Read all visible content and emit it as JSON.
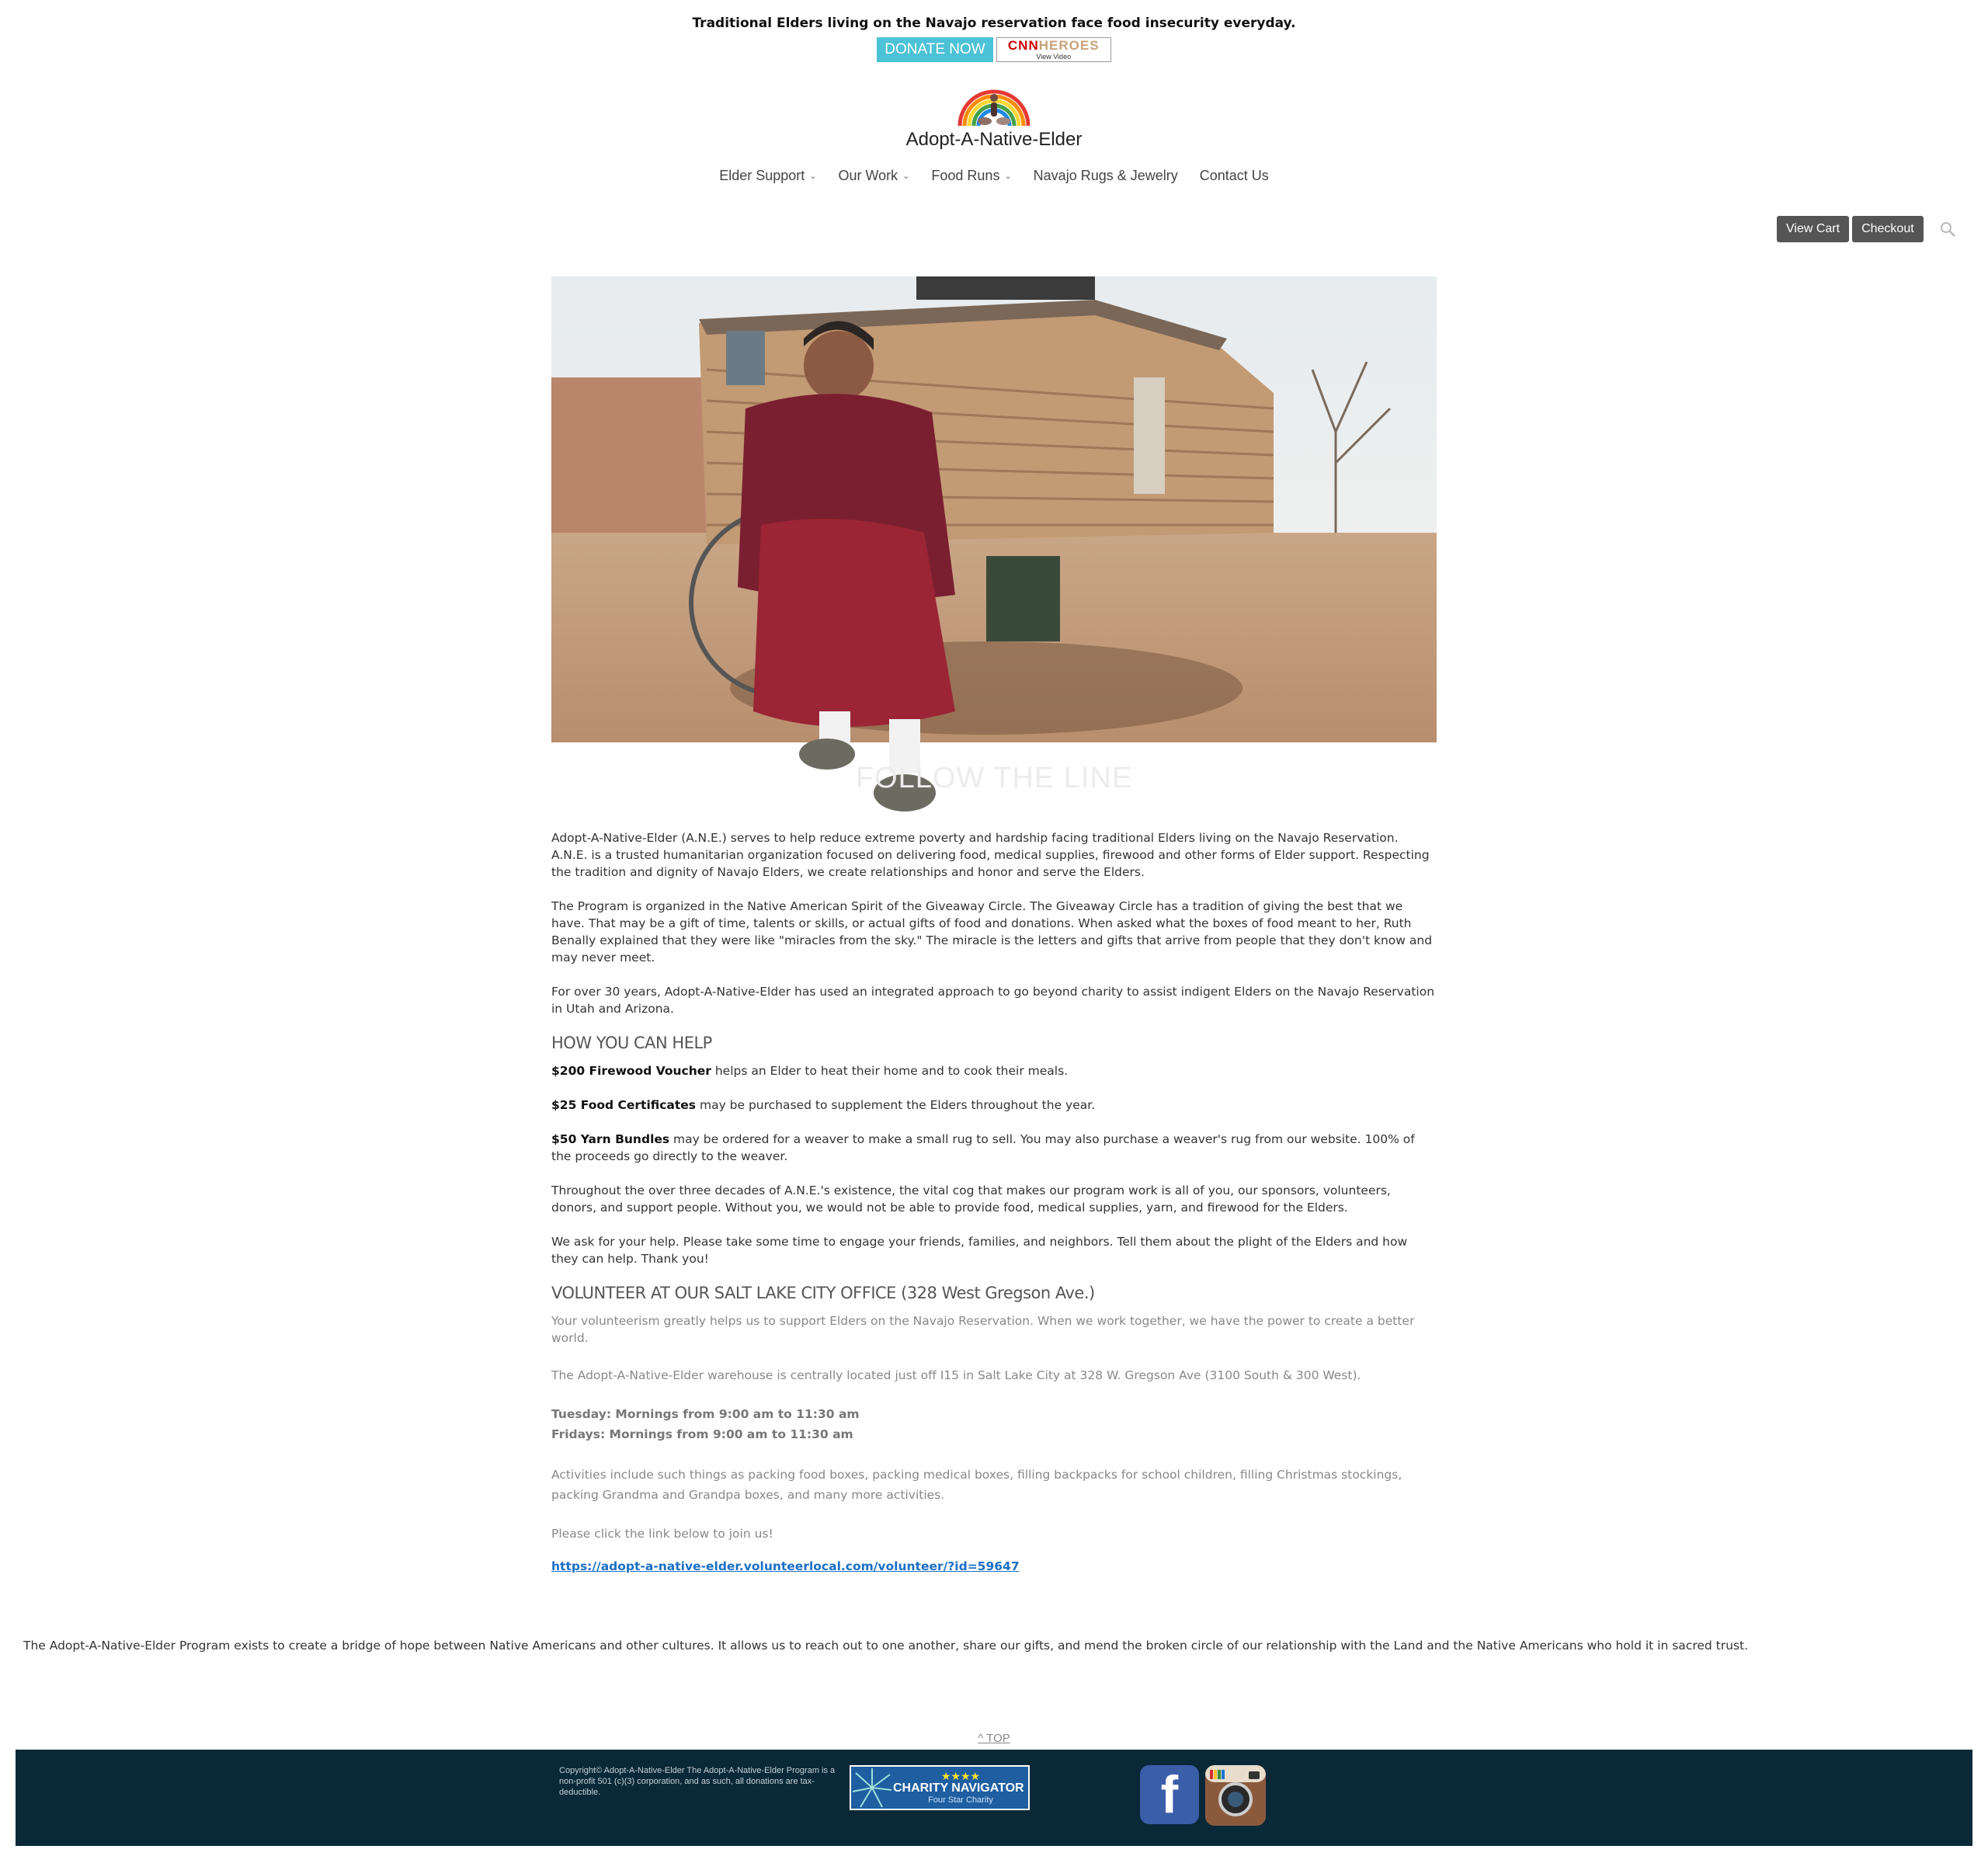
{
  "announcement": {
    "text": "Traditional Elders living on the Navajo reservation face food insecurity everyday.",
    "donate_label": "DONATE NOW",
    "cnn_logo_cnn": "CNN",
    "cnn_logo_heroes": "HEROES",
    "cnn_caption": "View Video"
  },
  "brand": {
    "name": "Adopt-A-Native-Elder"
  },
  "nav": {
    "items": [
      {
        "label": "Elder Support",
        "dropdown": true
      },
      {
        "label": "Our Work",
        "dropdown": true
      },
      {
        "label": "Food Runs",
        "dropdown": true
      },
      {
        "label": "Navajo Rugs & Jewelry",
        "dropdown": false
      },
      {
        "label": "Contact Us",
        "dropdown": false
      }
    ],
    "chevron": "⌄"
  },
  "cart": {
    "view_cart": "View Cart",
    "checkout": "Checkout",
    "search_icon": "search-icon"
  },
  "hero": {
    "overlay": "FOLLOW THE LINE"
  },
  "content": {
    "intro_p1": "Adopt-A-Native-Elder (A.N.E.) serves to help reduce extreme poverty and hardship facing traditional Elders living on the Navajo Reservation. A.N.E. is a trusted humanitarian organization focused on delivering food, medical supplies, firewood and other forms of Elder support. Respecting the tradition and dignity of Navajo Elders, we create relationships and honor and serve the Elders.",
    "intro_p2": "The Program is organized in the Native American Spirit of the Giveaway Circle. The Giveaway Circle has a tradition of giving the best that we have. That may be a gift of time, talents or skills, or actual gifts of food and donations. When asked what the boxes of food meant to her, Ruth Benally explained that they were like \"miracles from the sky.\" The miracle is the letters and gifts that arrive from people that they don't know and may never meet.",
    "intro_p3": "For over 30 years, Adopt-A-Native-Elder has used an integrated approach to go beyond charity to assist indigent Elders on the Navajo Reservation in Utah and Arizona.",
    "help_heading": "HOW YOU CAN HELP",
    "help_items": [
      {
        "bold": "$200 Firewood Voucher",
        "text": " helps an Elder to heat their home and to cook their meals."
      },
      {
        "bold": "$25 Food Certificates",
        "text": " may be purchased to supplement the Elders throughout the year."
      },
      {
        "bold": "$50 Yarn Bundles",
        "text": " may be ordered for a weaver to make a small rug to sell. You may also purchase a weaver's rug from our website. 100% of the proceeds go directly to the weaver."
      }
    ],
    "help_p4": "Throughout the over three decades of A.N.E.'s existence, the vital cog that makes our program work is all of you, our sponsors, volunteers, donors, and support people. Without you, we would not be able to provide food, medical supplies, yarn, and firewood for the Elders.",
    "help_p5": "We ask for your help. Please take some time to engage your friends, families, and neighbors. Tell them about the plight of the Elders and how they can help. Thank you!",
    "volunteer_heading": "VOLUNTEER AT OUR SALT LAKE CITY OFFICE (328 West Gregson Ave.)",
    "vol_p1": "Your volunteerism greatly helps us to support Elders on the Navajo Reservation. When we work together, we have the power to create a better world.",
    "vol_p2": "The Adopt-A-Native-Elder warehouse is centrally located just off I15 in Salt Lake City at 328 W. Gregson Ave (3100 South & 300 West).",
    "vol_hours1": "Tuesday: Mornings from 9:00 am to 11:30 am",
    "vol_hours2": "Fridays: Mornings from 9:00 am to 11:30 am",
    "vol_p3": "Activities include such things as packing food boxes, packing medical boxes, filling backpacks for school children, filling Christmas stockings, packing Grandma and Grandpa boxes, and many more activities.",
    "vol_p4": "Please click the link below to join us!",
    "vol_link": "https://adopt-a-native-elder.volunteerlocal.com/volunteer/?id=59647"
  },
  "mission": "The Adopt-A-Native-Elder Program exists to create a bridge of hope between Native Americans and other cultures. It allows us to reach out to one another, share our gifts, and mend the broken circle of our relationship with the Land and the Native Americans who hold it in sacred trust.",
  "to_top": "^ TOP",
  "footer": {
    "copyright": "Copyright© Adopt-A-Native-Elder The Adopt-A-Native-Elder Program is a non-profit 501 (c)(3) corporation, and as such, all donations are tax-deductible.",
    "cn_stars": "★★★★",
    "cn_title": "CHARITY NAVIGATOR",
    "cn_subtitle": "Four Star Charity",
    "facebook_glyph": "f"
  },
  "colors": {
    "donate": "#4cc2d6",
    "footer_bg": "#092838",
    "link": "#1a6fc4",
    "cart_button": "#555555"
  }
}
